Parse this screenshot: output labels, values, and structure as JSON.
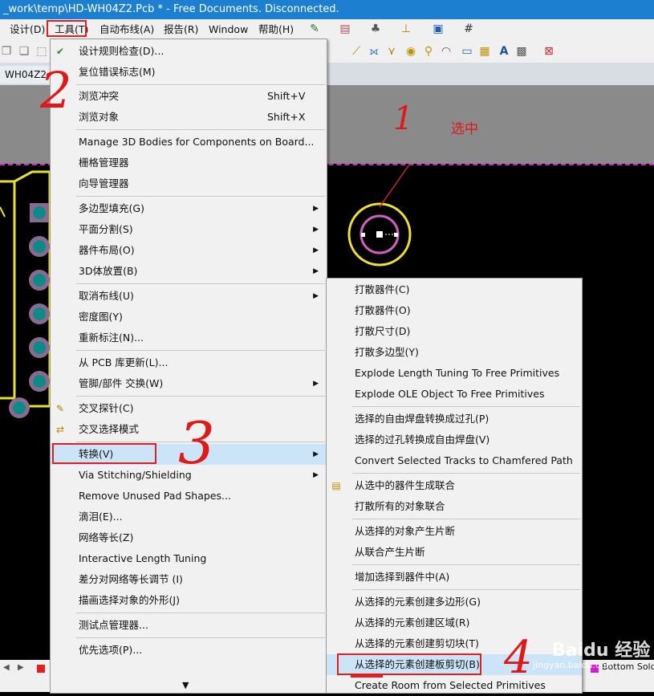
{
  "window": {
    "title": "_work\\temp\\HD-WH04Z2.Pcb * - Free Documents. Disconnected."
  },
  "menubar": [
    "设计(D)",
    "工具(T)",
    "自动布线(A)",
    "报告(R)",
    "Window",
    "帮助(H)"
  ],
  "doc_tab": "WH04Z2.Pcb",
  "tools_menu": {
    "items": [
      "设计规则检查(D)...",
      "复位错误标志(M)",
      "浏览冲突",
      "浏览对象",
      "Manage 3D Bodies for Components on Board...",
      "栅格管理器",
      "向导管理器",
      "多边型填充(G)",
      "平面分割(S)",
      "器件布局(O)",
      "3D体放置(B)",
      "取消布线(U)",
      "密度图(Y)",
      "重新标注(N)...",
      "从 PCB 库更新(L)...",
      "管脚/部件 交换(W)",
      "交叉探针(C)",
      "交叉选择模式",
      "转换(V)",
      "Via Stitching/Shielding",
      "Remove Unused Pad Shapes...",
      "滴泪(E)...",
      "网络等长(Z)",
      "Interactive Length Tuning",
      "差分对网络等长调节 (I)",
      "描画选择对象的外形(J)",
      "测试点管理器...",
      "优先选项(P)..."
    ],
    "shortcuts": {
      "browse_violations": "Shift+V",
      "browse_objects": "Shift+X"
    },
    "more_indicator": "▼"
  },
  "convert_menu": {
    "items": [
      "打散器件(C)",
      "打散器件(O)",
      "打散尺寸(D)",
      "打散多边型(Y)",
      "Explode Length Tuning To Free Primitives",
      "Explode OLE Object To Free Primitives",
      "选择的自由焊盘转换成过孔(P)",
      "选择的过孔转换成自由焊盘(V)",
      "Convert Selected Tracks to Chamfered Path",
      "从选中的器件生成联合",
      "打散所有的对象联合",
      "从选择的对象产生片断",
      "从联合产生片断",
      "增加选择到器件中(A)",
      "从选择的元素创建多边形(G)",
      "从选择的元素创建区域(R)",
      "从选择的元素创建剪切块(T)",
      "从选择的元素创建板剪切(B)",
      "Create Room from Selected Primitives"
    ]
  },
  "annotations": {
    "step1": "1",
    "step1_note": "选中",
    "step2": "2",
    "step3": "3",
    "step4": "4"
  },
  "statusbar": {
    "layer_tab": "Bottom Sold"
  },
  "watermark": {
    "brand": "Baidu 经验",
    "url": "jingyan.baidu.com"
  },
  "colors": {
    "title_bar": "#1d7fd0",
    "menu_bg": "#f1f1f1",
    "highlight": "#cce4f7",
    "annotation": "#e01818",
    "board_edge": "#d020d0",
    "silkscreen": "#e8e030",
    "pad": "#0e8a86"
  }
}
